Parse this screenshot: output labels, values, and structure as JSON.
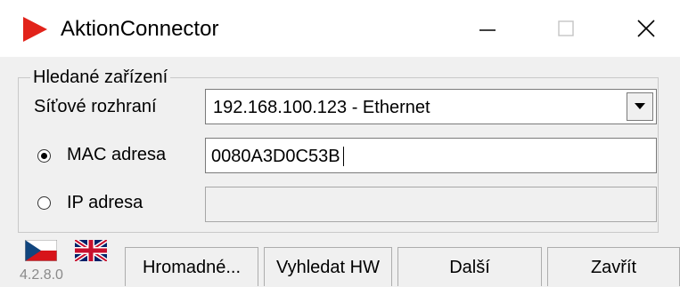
{
  "window": {
    "title": "AktionConnector",
    "icon": "play-icon",
    "brand_color": "#e2231a"
  },
  "group": {
    "legend": "Hledané zařízení",
    "network": {
      "label": "Síťové rozhraní",
      "selected": "192.168.100.123 - Ethernet"
    },
    "mac": {
      "label": "MAC adresa",
      "selected": true,
      "value": "0080A3D0C53B"
    },
    "ip": {
      "label": "IP adresa",
      "selected": false,
      "value": ""
    }
  },
  "footer": {
    "version": "4.2.8.0",
    "flags": [
      "czech-flag-icon",
      "uk-flag-icon"
    ],
    "buttons": {
      "bulk": "Hromadné...",
      "find_hw": "Vyhledat HW",
      "next": "Další",
      "close": "Zavřít"
    }
  }
}
